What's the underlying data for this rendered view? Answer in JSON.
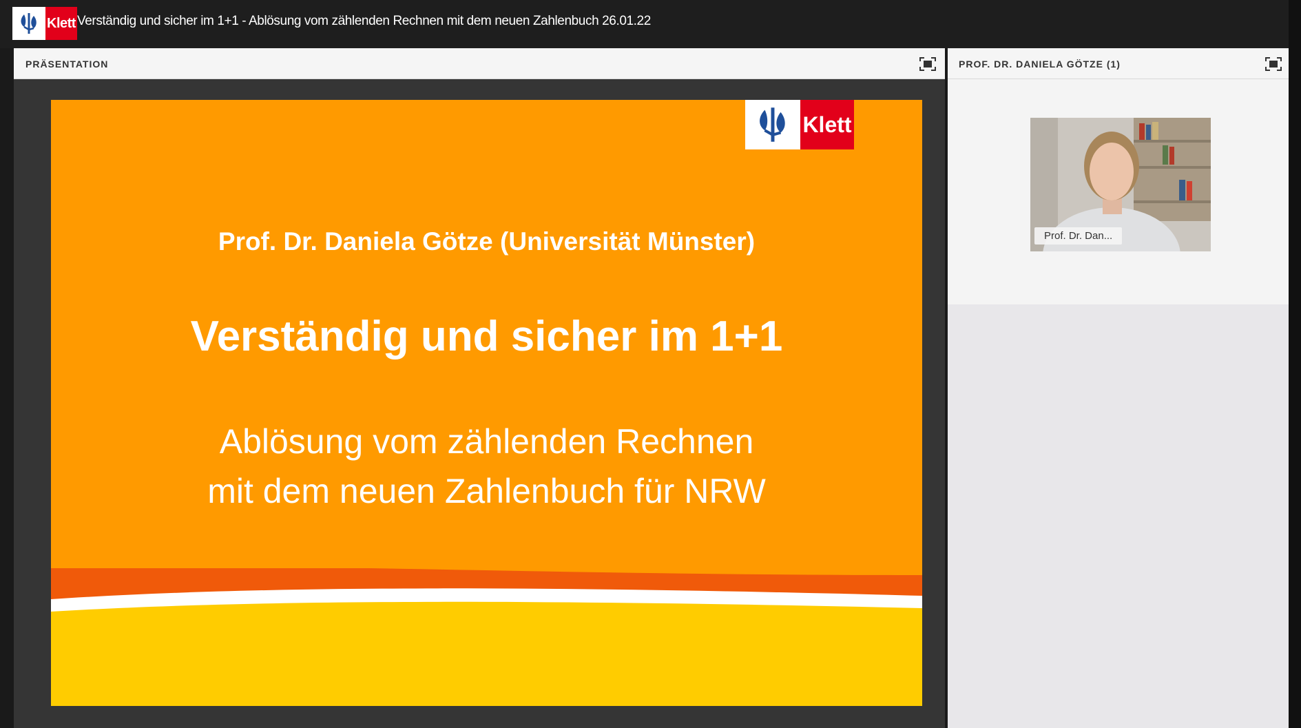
{
  "window": {
    "title": "Verständig und sicher im 1+1 - Ablösung vom zählenden Rechnen mit dem neuen Zahlenbuch 26.01.22",
    "logo_text": "Klett"
  },
  "presentation_pod": {
    "label": "PRÄSENTATION",
    "fullscreen_icon": "fullscreen-icon"
  },
  "slide": {
    "logo_text": "Klett",
    "author": "Prof. Dr. Daniela Götze (Universität Münster)",
    "title": "Verständig und sicher im 1+1",
    "subtitle_line1": "Ablösung vom zählenden Rechnen",
    "subtitle_line2": "mit dem neuen Zahlenbuch für NRW",
    "colors": {
      "background": "#ff9a00",
      "wave_red": "#f05a0a",
      "wave_yellow": "#ffcc00",
      "logo_red": "#e2001a"
    }
  },
  "camera_pod": {
    "label": "PROF. DR. DANIELA GÖTZE (1)",
    "name_tag": "Prof. Dr. Dan...",
    "fullscreen_icon": "fullscreen-icon"
  }
}
